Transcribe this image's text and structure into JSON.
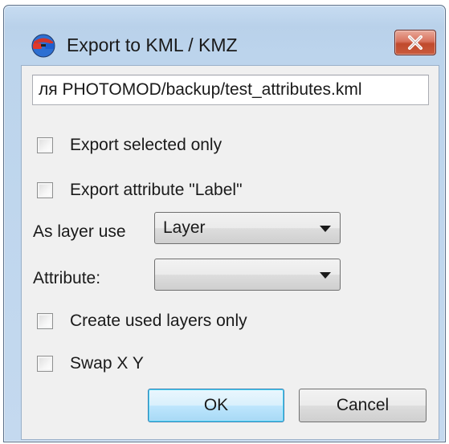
{
  "window": {
    "title": "Export to KML / KMZ"
  },
  "path": {
    "value": "ля PHOTOMOD/backup/test_attributes.kml"
  },
  "options": {
    "export_selected_only": {
      "label": "Export selected only",
      "checked": false
    },
    "export_attribute_label": {
      "label": "Export attribute \"Label\"",
      "checked": false
    },
    "create_used_layers_only": {
      "label": "Create used layers only",
      "checked": false
    },
    "swap_xy": {
      "label": "Swap X Y",
      "checked": false
    }
  },
  "layer_use": {
    "label": "As layer use",
    "selected": "Layer"
  },
  "attribute": {
    "label": "Attribute:",
    "selected": ""
  },
  "buttons": {
    "ok": "OK",
    "cancel": "Cancel"
  },
  "icons": {
    "app": "3d-glasses-icon",
    "close": "close-icon",
    "dropdown": "chevron-down-icon"
  }
}
